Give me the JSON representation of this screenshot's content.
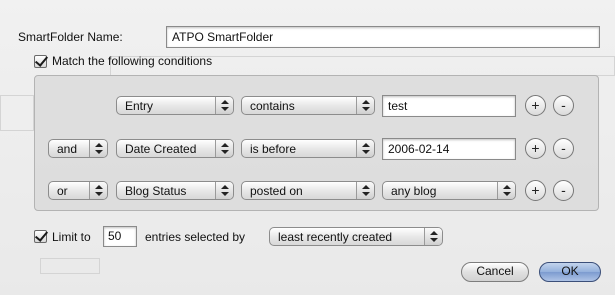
{
  "form": {
    "name_label": "SmartFolder Name:",
    "name_value": "ATPO SmartFolder",
    "match_label": "Match the following conditions",
    "match_checked": true
  },
  "conditions": [
    {
      "conjunction": "",
      "field": "Entry",
      "operator": "contains",
      "value": "test",
      "value_type": "text"
    },
    {
      "conjunction": "and",
      "field": "Date Created",
      "operator": "is before",
      "value": "2006-02-14",
      "value_type": "text"
    },
    {
      "conjunction": "or",
      "field": "Blog Status",
      "operator": "posted on",
      "value": "any blog",
      "value_type": "popup"
    }
  ],
  "row_buttons": {
    "add": "+",
    "remove": "-"
  },
  "limit": {
    "checked": true,
    "label_prefix": "Limit to",
    "count": "50",
    "label_suffix": "entries selected by",
    "order": "least recently created"
  },
  "buttons": {
    "cancel": "Cancel",
    "ok": "OK"
  }
}
